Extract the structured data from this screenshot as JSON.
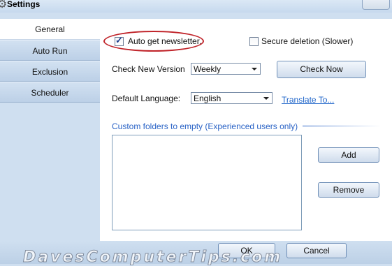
{
  "window": {
    "title": "Settings",
    "icon": "gear-icon"
  },
  "sidebar": {
    "items": [
      {
        "label": "General",
        "active": true
      },
      {
        "label": "Auto Run",
        "active": false
      },
      {
        "label": "Exclusion",
        "active": false
      },
      {
        "label": "Scheduler",
        "active": false
      }
    ]
  },
  "general": {
    "auto_newsletter": {
      "label": "Auto get newsletter.",
      "checked": true
    },
    "secure_deletion": {
      "label": "Secure deletion (Slower)",
      "checked": false
    },
    "check_version": {
      "label": "Check New Version",
      "value": "Weekly"
    },
    "check_now_label": "Check Now",
    "language": {
      "label": "Default Language:",
      "value": "English"
    },
    "translate_link": "Translate To...",
    "custom_folders_title": "Custom folders to empty (Experienced users only)",
    "custom_folders_items": [],
    "add_label": "Add",
    "remove_label": "Remove"
  },
  "footer": {
    "ok_label": "OK",
    "cancel_label": "Cancel"
  },
  "watermark": "DavesComputerTips.com",
  "colors": {
    "highlight": "#c0242a",
    "link": "#1c63c9",
    "accent": "#2a63c6"
  }
}
